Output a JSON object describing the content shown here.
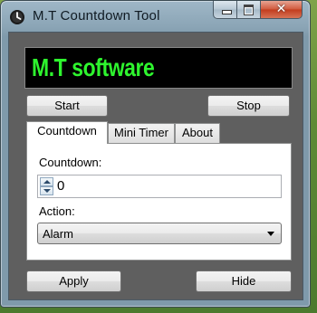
{
  "window": {
    "title": "M.T  Countdown Tool",
    "icon": "clock-icon",
    "close_glyph": "✕"
  },
  "display": {
    "text": "M.T software",
    "text_color": "#2ef52e",
    "background_color": "#000000"
  },
  "controls": {
    "start_label": "Start",
    "stop_label": "Stop",
    "apply_label": "Apply",
    "hide_label": "Hide"
  },
  "tabs": [
    {
      "label": "Countdown",
      "active": true
    },
    {
      "label": "Mini Timer",
      "active": false
    },
    {
      "label": "About",
      "active": false
    }
  ],
  "countdown_panel": {
    "countdown_label": "Countdown:",
    "countdown_value": "0",
    "action_label": "Action:",
    "action_selected": "Alarm"
  }
}
